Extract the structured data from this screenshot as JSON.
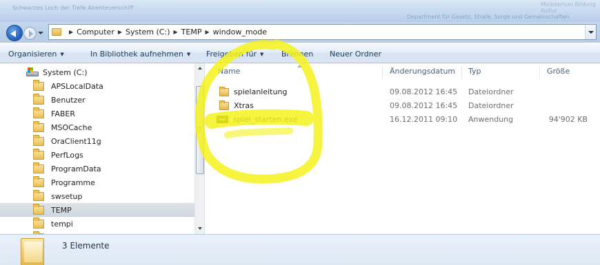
{
  "window": {
    "title": "Schwarzes Loch der Tiefe Abenteuerschiff",
    "header_right": "Department für Gesetz, Strafe, Sorge und Gemeinschaften",
    "header_far_right": "Ministerium Bildung Kultur"
  },
  "address_bar": {
    "crumbs": [
      "Computer",
      "System (C:)",
      "TEMP",
      "window_mode"
    ]
  },
  "toolbar": {
    "organize": "Organisieren",
    "add_to_library": "In Bibliothek aufnehmen",
    "share_with": "Freigeben für",
    "burn": "Brennen",
    "new_folder": "Neuer Ordner",
    "dropdown_glyph": "▼"
  },
  "nav_pane": {
    "drive": "System (C:)",
    "folders": [
      "APSLocalData",
      "Benutzer",
      "FABER",
      "MSOCache",
      "OraClient11g",
      "PerfLogs",
      "ProgramData",
      "Programme",
      "swsetup",
      "TEMP",
      "tempi"
    ],
    "selected": "TEMP"
  },
  "file_list": {
    "columns": {
      "name": "Name",
      "date": "Änderungsdatum",
      "type": "Typ",
      "size": "Größe"
    },
    "rows": [
      {
        "name": "spielanleitung",
        "date": "09.08.2012 16:45",
        "type": "Dateiordner",
        "size": "",
        "icon": "folder-icon"
      },
      {
        "name": "Xtras",
        "date": "09.08.2012 16:45",
        "type": "Dateiordner",
        "size": "",
        "icon": "folder-icon"
      },
      {
        "name": "spiel_starten.exe",
        "date": "16.12.2011 09:10",
        "type": "Anwendung",
        "size": "94'902 KB",
        "icon": "application-icon"
      }
    ]
  },
  "details_pane": {
    "count": "3 Elemente"
  },
  "colors": {
    "highlight_marker": "#f4f21c",
    "selected_bg": "#d4dae1",
    "header_text": "#4c607a"
  }
}
